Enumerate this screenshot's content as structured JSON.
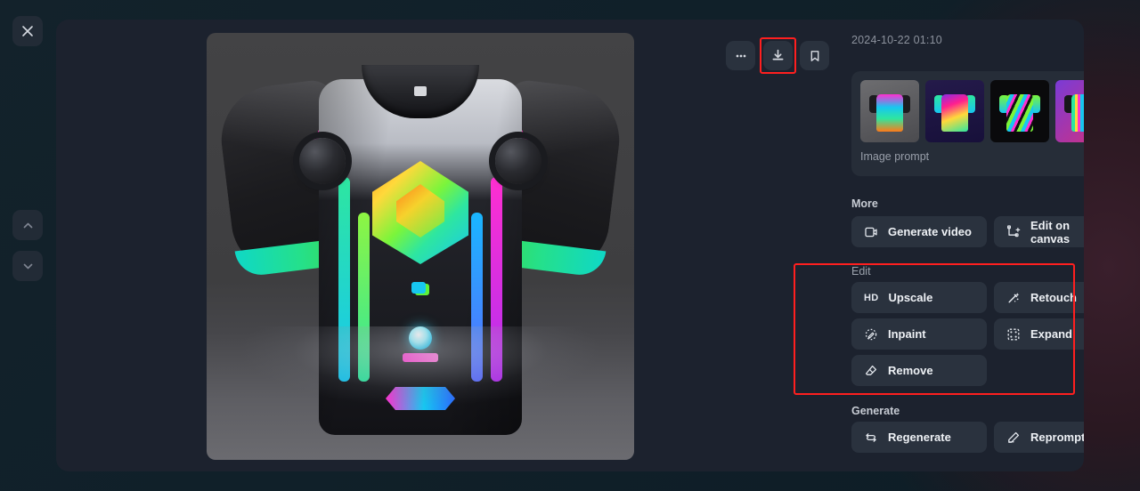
{
  "window": {
    "close_label": "×",
    "nav_up_label": "chevron-up",
    "nav_down_label": "chevron-down"
  },
  "toolbar": {
    "more_label": "•••",
    "download_label": "download",
    "bookmark_label": "bookmark",
    "highlighted": "download"
  },
  "sidebar": {
    "timestamp": "2024-10-22 01:10",
    "prompt_card": {
      "label": "Image prompt",
      "thumbnails": [
        {
          "name": "neon-mech-tshirt",
          "alt": "Neon mech armor t-shirt"
        },
        {
          "name": "rainbow-gradient-tshirt",
          "alt": "Rainbow gradient t-shirt"
        },
        {
          "name": "symmetric-neon-tshirt",
          "alt": "Symmetric neon pattern t-shirt"
        },
        {
          "name": "vertical-stripe-tshirt",
          "alt": "Vertical neon stripe t-shirt"
        }
      ]
    },
    "sections": [
      {
        "id": "more",
        "label": "More",
        "buttons": [
          {
            "id": "generate-video",
            "label": "Generate video",
            "icon": "video-icon"
          },
          {
            "id": "edit-on-canvas",
            "label": "Edit on canvas",
            "icon": "canvas-transform-icon"
          }
        ]
      },
      {
        "id": "edit",
        "label": "Edit",
        "highlighted": true,
        "buttons": [
          {
            "id": "upscale",
            "label": "Upscale",
            "icon": "hd-icon"
          },
          {
            "id": "retouch",
            "label": "Retouch",
            "icon": "magic-wand-icon"
          },
          {
            "id": "inpaint",
            "label": "Inpaint",
            "icon": "brush-circle-icon"
          },
          {
            "id": "expand",
            "label": "Expand",
            "icon": "expand-frame-icon"
          },
          {
            "id": "remove",
            "label": "Remove",
            "icon": "eraser-icon"
          }
        ]
      },
      {
        "id": "generate",
        "label": "Generate",
        "buttons": [
          {
            "id": "regenerate",
            "label": "Regenerate",
            "icon": "loop-arrows-icon"
          },
          {
            "id": "reprompt",
            "label": "Reprompt",
            "icon": "pencil-icon"
          }
        ]
      }
    ]
  },
  "preview": {
    "alt": "Neon mech armor graphic t-shirt on dark gray backdrop"
  },
  "colors": {
    "highlight": "#ff1f1f",
    "panel": "#1c222e",
    "button": "#2a323e",
    "text": "#eef1f5",
    "muted": "#99a0ab"
  }
}
